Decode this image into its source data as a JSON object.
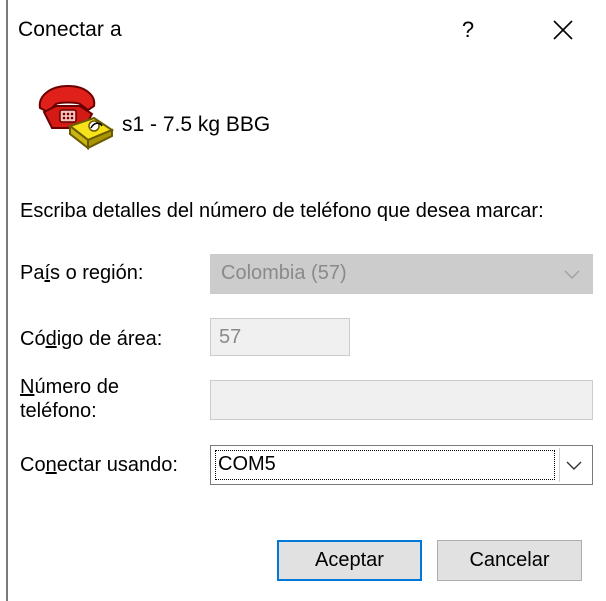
{
  "window": {
    "title": "Conectar a",
    "help_label": "?",
    "close_label": "Close"
  },
  "connection": {
    "name": "s1 - 7.5 kg BBG",
    "icon": "phone-modem-icon"
  },
  "instructions": "Escriba detalles del número de teléfono que desea marcar:",
  "form": {
    "country": {
      "label_pre": "Pa",
      "label_accel": "í",
      "label_post": "s o región:",
      "value": "Colombia (57)",
      "enabled": false
    },
    "area_code": {
      "label_pre": "Có",
      "label_accel": "d",
      "label_post": "igo de área:",
      "value": "57",
      "enabled": false
    },
    "phone_number": {
      "label_line1_accel": "N",
      "label_line1_post": "úmero de",
      "label_line2": "teléfono:",
      "value": "",
      "enabled": false
    },
    "connect_using": {
      "label_pre": "Co",
      "label_accel": "n",
      "label_post": "ectar usando:",
      "value": "COM5",
      "enabled": true
    }
  },
  "buttons": {
    "ok_label": "Aceptar",
    "cancel_label": "Cancelar"
  },
  "colors": {
    "accent": "#0078d7",
    "disabled_fill": "#cccccc",
    "disabled_text": "#8a8a8a",
    "phone_red": "#e0201a",
    "phone_yellow": "#f5e21a"
  }
}
